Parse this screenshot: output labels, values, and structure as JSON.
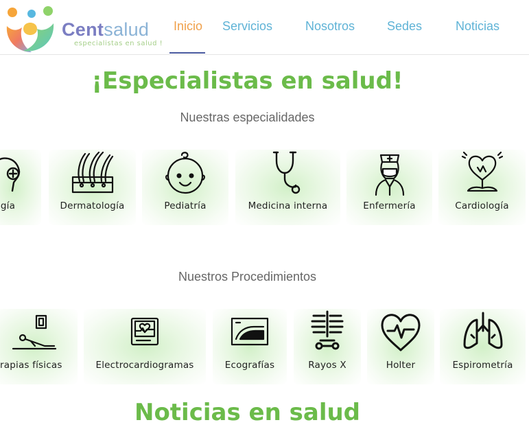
{
  "header": {
    "brand_part1": "Cent",
    "brand_part2": "salud",
    "tagline": "especialistas en salud !",
    "nav": [
      "Inicio",
      "Servicios",
      "Nosotros",
      "Sedes",
      "Noticias"
    ]
  },
  "hero": {
    "title": "¡Especialistas en salud!",
    "specialties_subtitle": "Nuestras especialidades",
    "procedures_subtitle": "Nuestros Procedimientos"
  },
  "specialties": [
    {
      "label": "ología",
      "icon": "head-cross-icon"
    },
    {
      "label": "Dermatología",
      "icon": "hair-follicle-icon"
    },
    {
      "label": "Pediatría",
      "icon": "baby-face-icon"
    },
    {
      "label": "Medicina interna",
      "icon": "stethoscope-icon"
    },
    {
      "label": "Enfermería",
      "icon": "nurse-icon"
    },
    {
      "label": "Cardiología",
      "icon": "heart-hands-icon"
    }
  ],
  "procedures": [
    {
      "label": "rapias físicas",
      "icon": "physiotherapy-icon"
    },
    {
      "label": "Electrocardiogramas",
      "icon": "ecg-monitor-icon"
    },
    {
      "label": "Ecografías",
      "icon": "ultrasound-icon"
    },
    {
      "label": "Rayos X",
      "icon": "xray-spine-icon"
    },
    {
      "label": "Holter",
      "icon": "heart-pulse-icon"
    },
    {
      "label": "Espirometría",
      "icon": "lungs-icon"
    }
  ],
  "news": {
    "title": "Noticias en salud"
  },
  "colors": {
    "accent_green": "#6bbb4a",
    "nav_blue": "#5fb3d6",
    "nav_active": "#f0a04a",
    "card_tint": "#d2f0c8"
  }
}
